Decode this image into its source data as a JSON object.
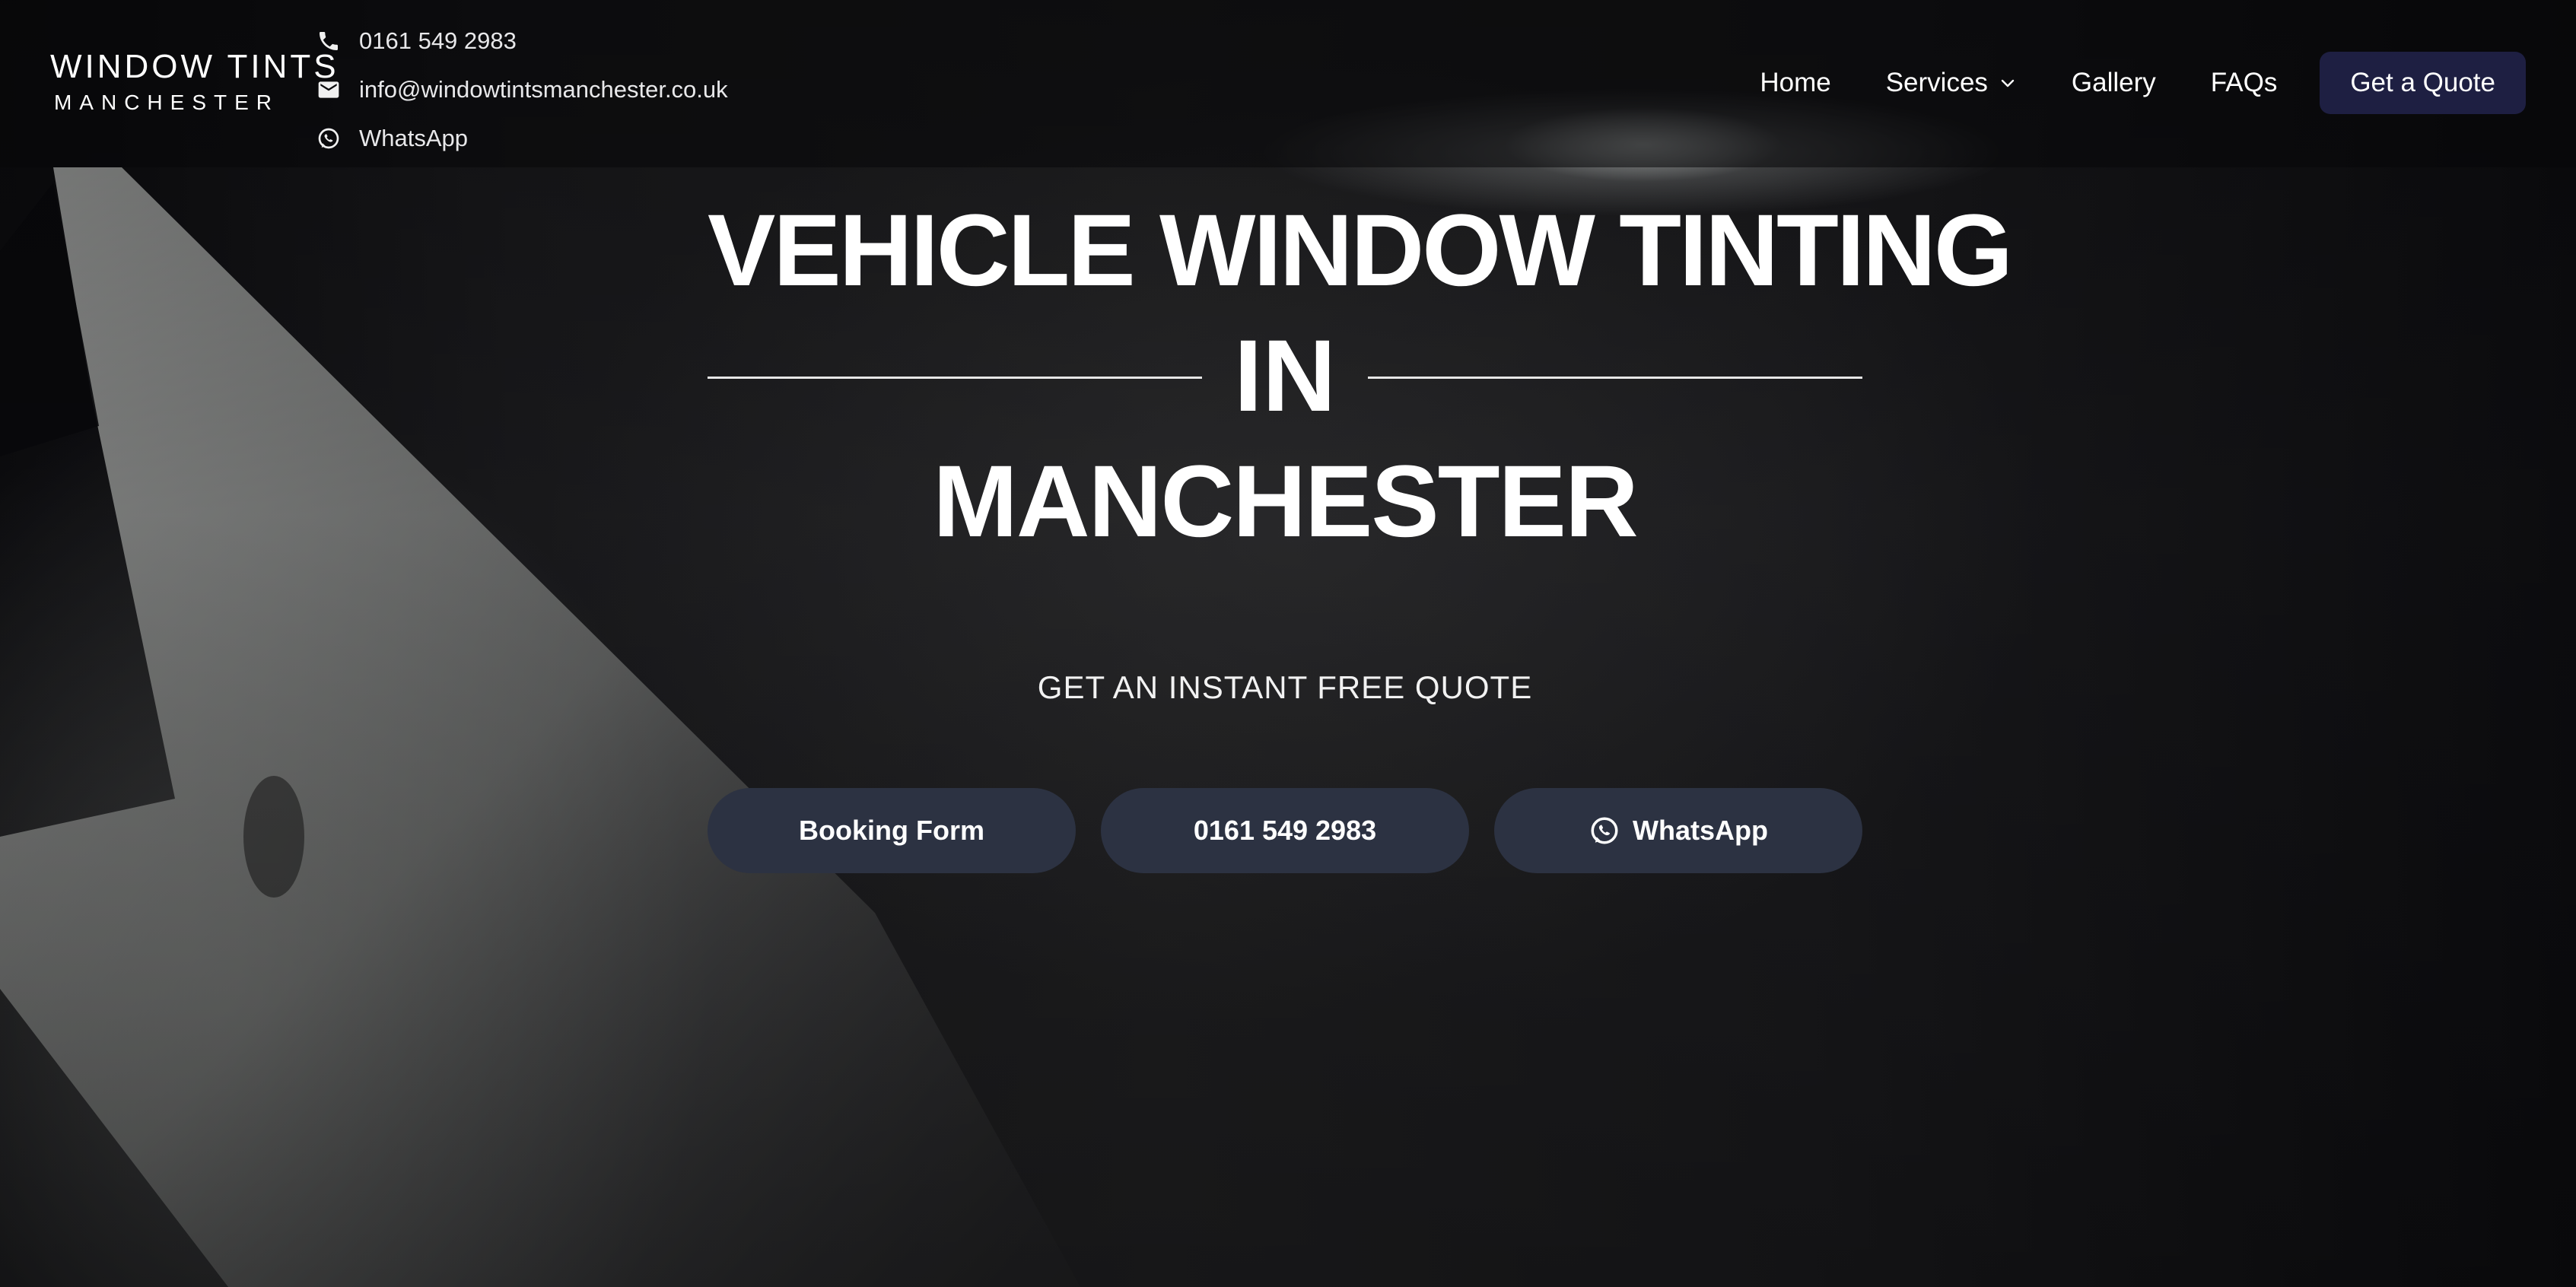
{
  "brand": {
    "name_top": "WINDOW TINTS",
    "name_bottom": "MANCHESTER"
  },
  "contact": {
    "phone": "0161 549 2983",
    "email": "info@windowtintsmanchester.co.uk",
    "whatsapp": "WhatsApp"
  },
  "nav": {
    "home": "Home",
    "services": "Services",
    "gallery": "Gallery",
    "faqs": "FAQs",
    "quote": "Get a Quote"
  },
  "hero": {
    "line1": "VEHICLE WINDOW TINTING",
    "line2": "IN",
    "line3": "MANCHESTER",
    "subheading": "GET AN INSTANT FREE QUOTE"
  },
  "cta": {
    "booking": "Booking Form",
    "phone": "0161 549 2983",
    "whatsapp": "WhatsApp"
  },
  "colors": {
    "quote_button": "#1e1f42",
    "cta_button": "#2c3242",
    "header_bg": "#08080a"
  },
  "icons": {
    "phone": "phone-icon",
    "email": "email-icon",
    "whatsapp": "whatsapp-icon",
    "dropdown": "chevron-down-icon"
  }
}
